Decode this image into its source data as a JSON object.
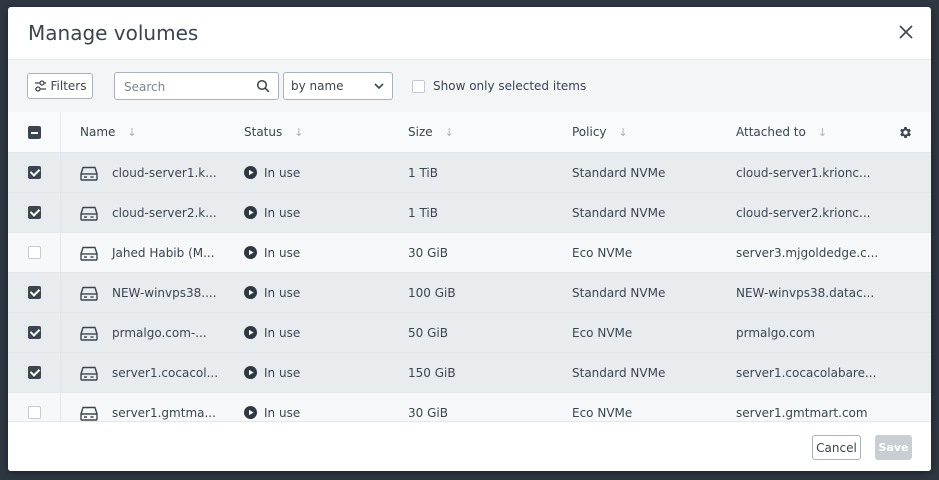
{
  "dialog": {
    "title": "Manage volumes",
    "close_icon": "close-icon"
  },
  "toolbar": {
    "filters_label": "Filters",
    "search_placeholder": "Search",
    "search_value": "",
    "sort_selected": "by name",
    "show_selected_label": "Show only selected items",
    "show_selected_checked": false
  },
  "table": {
    "columns": [
      "Name",
      "Status",
      "Size",
      "Policy",
      "Attached to"
    ],
    "rows": [
      {
        "checked": true,
        "name": "cloud-server1.k...",
        "status": "In use",
        "size": "1 TiB",
        "policy": "Standard NVMe",
        "attached": "cloud-server1.krionc..."
      },
      {
        "checked": true,
        "name": "cloud-server2.k...",
        "status": "In use",
        "size": "1 TiB",
        "policy": "Standard NVMe",
        "attached": "cloud-server2.krionc..."
      },
      {
        "checked": false,
        "name": "Jahed Habib (M...",
        "status": "In use",
        "size": "30 GiB",
        "policy": "Eco NVMe",
        "attached": "server3.mjgoldedge.c..."
      },
      {
        "checked": true,
        "name": "NEW-winvps38....",
        "status": "In use",
        "size": "100 GiB",
        "policy": "Standard NVMe",
        "attached": "NEW-winvps38.datac..."
      },
      {
        "checked": true,
        "name": "prmalgo.com-...",
        "status": "In use",
        "size": "50 GiB",
        "policy": "Eco NVMe",
        "attached": "prmalgo.com"
      },
      {
        "checked": true,
        "name": "server1.cocacol...",
        "status": "In use",
        "size": "150 GiB",
        "policy": "Standard NVMe",
        "attached": "server1.cocacolabare..."
      },
      {
        "checked": false,
        "name": "server1.gmtma...",
        "status": "In use",
        "size": "30 GiB",
        "policy": "Eco NVMe",
        "attached": "server1.gmtmart.com"
      }
    ]
  },
  "footer": {
    "cancel_label": "Cancel",
    "save_label": "Save"
  },
  "colors": {
    "dark": "#3b4550",
    "selected_row": "#e9ecef",
    "disabled_button": "#c9ced3"
  }
}
